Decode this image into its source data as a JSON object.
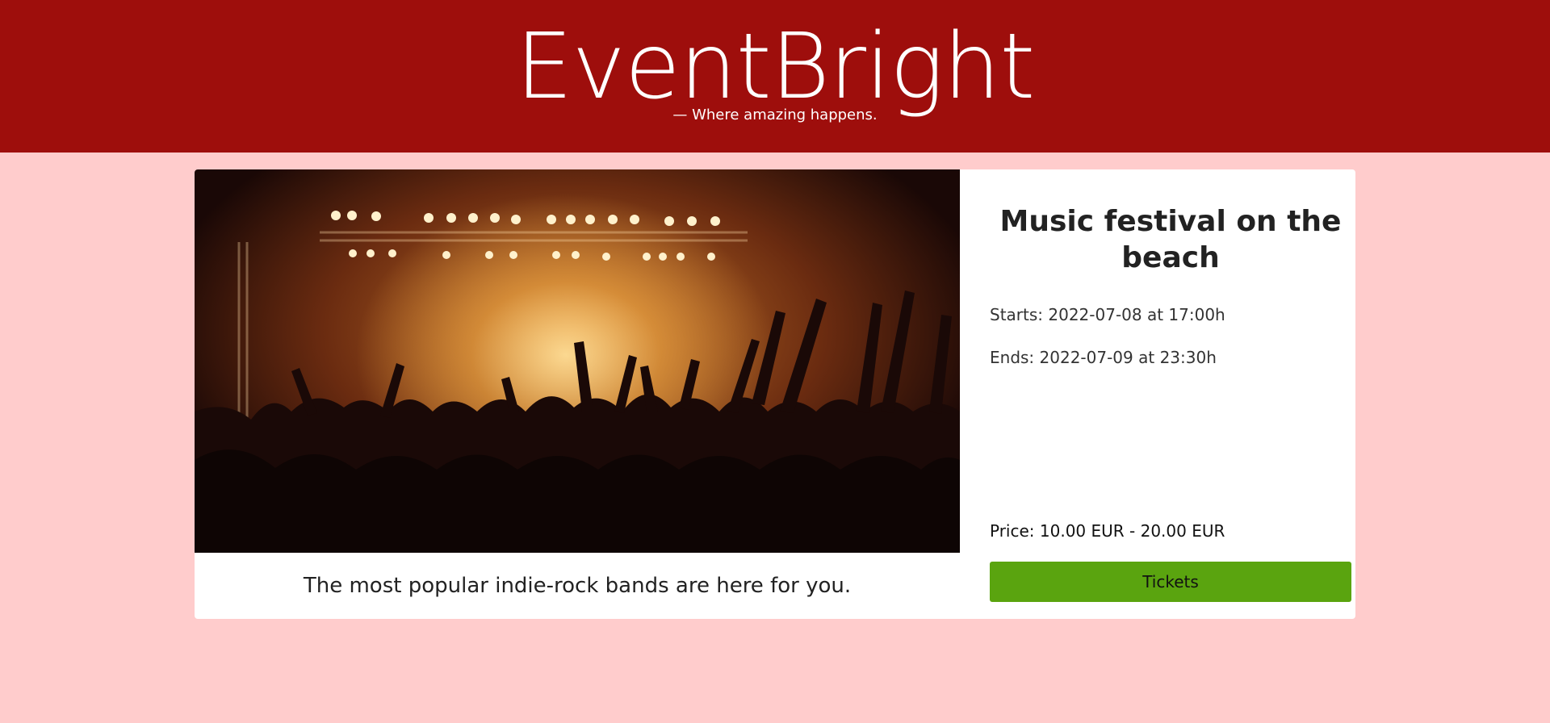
{
  "header": {
    "brand": "EventBright",
    "tagline": "— Where amazing happens."
  },
  "event": {
    "image_alt": "concert-crowd-image",
    "caption": "The most popular indie-rock bands are here for you.",
    "title": "Music festival on the beach",
    "starts": "Starts: 2022-07-08 at 17:00h",
    "ends": "Ends: 2022-07-09 at 23:30h",
    "price": "Price: 10.00 EUR - 20.00 EUR",
    "tickets_label": "Tickets"
  },
  "colors": {
    "header_bg": "#9e0e0c",
    "page_bg": "#ffcccc",
    "button_bg": "#5aa40f"
  }
}
